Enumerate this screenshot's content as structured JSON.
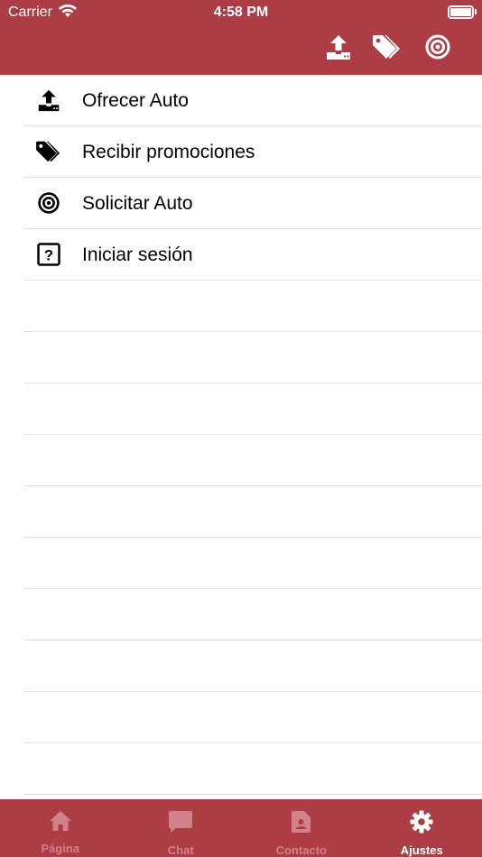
{
  "status_bar": {
    "carrier": "Carrier",
    "time": "4:58 PM"
  },
  "nav_actions": [
    {
      "icon": "upload-icon"
    },
    {
      "icon": "tags-icon"
    },
    {
      "icon": "target-icon"
    }
  ],
  "menu": {
    "items": [
      {
        "label": "Ofrecer Auto",
        "icon": "upload-icon"
      },
      {
        "label": "Recibir promociones",
        "icon": "tags-icon"
      },
      {
        "label": "Solicitar Auto",
        "icon": "target-icon"
      },
      {
        "label": "Iniciar sesión",
        "icon": "question-box-icon"
      }
    ]
  },
  "tabbar": {
    "tabs": [
      {
        "label": "Página",
        "icon": "home-icon",
        "active": false
      },
      {
        "label": "Chat",
        "icon": "chat-icon",
        "active": false
      },
      {
        "label": "Contacto",
        "icon": "contact-icon",
        "active": false
      },
      {
        "label": "Ajustes",
        "icon": "gear-icon",
        "active": true
      }
    ]
  },
  "colors": {
    "brand": "#ac3d45",
    "tab_inactive": "#d28189",
    "tab_active": "#ffffff",
    "separator": "#e0e0e3"
  }
}
